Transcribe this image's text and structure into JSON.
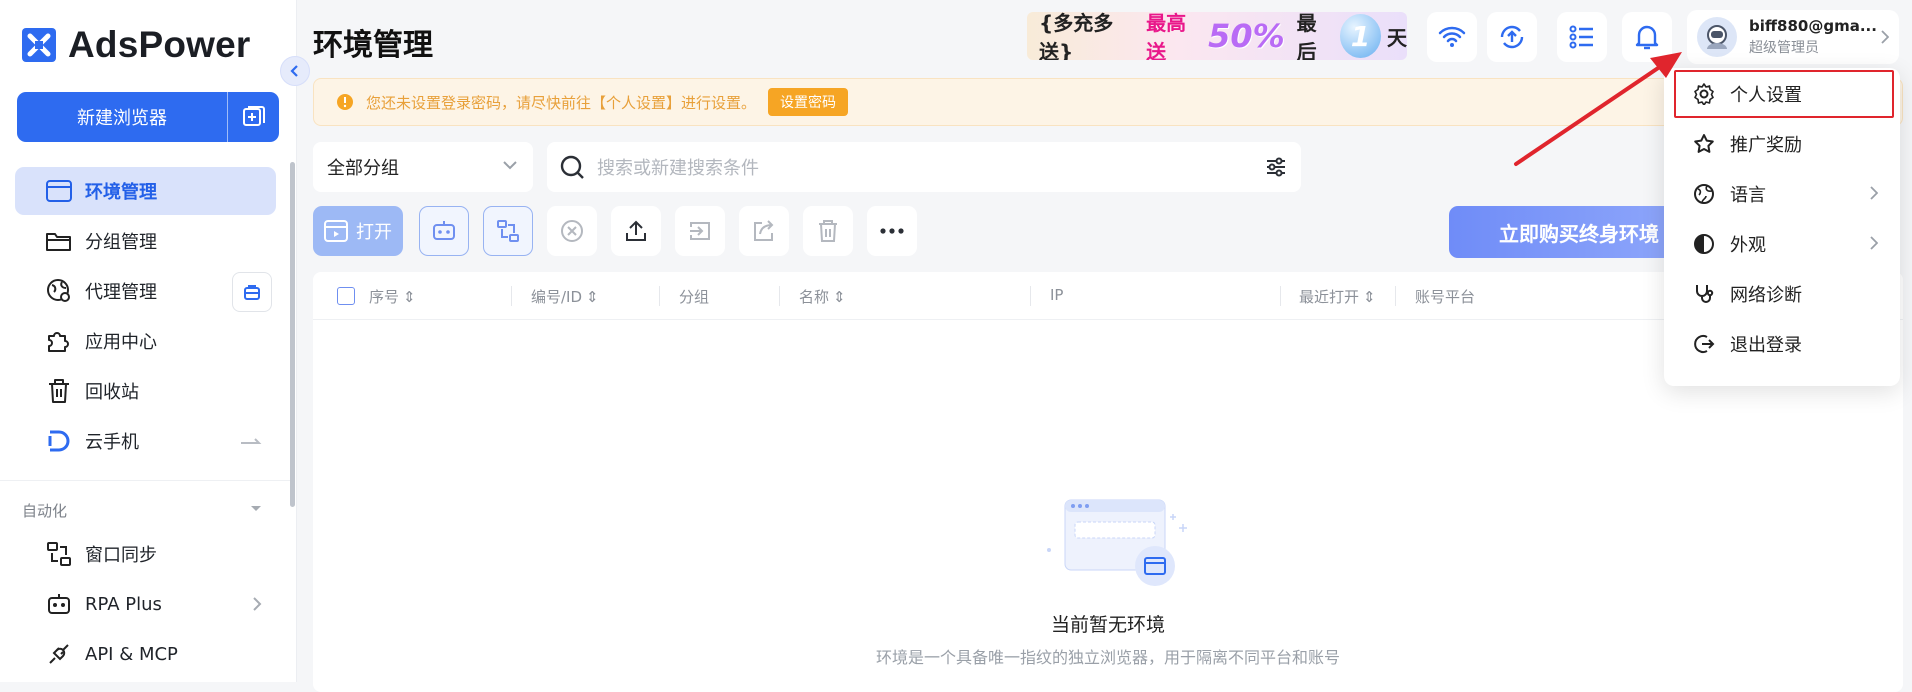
{
  "brand": {
    "name": "AdsPower"
  },
  "sidebar": {
    "new_browser": "新建浏览器",
    "nav": [
      {
        "label": "环境管理"
      },
      {
        "label": "分组管理"
      },
      {
        "label": "代理管理"
      },
      {
        "label": "应用中心"
      },
      {
        "label": "回收站"
      },
      {
        "label": "云手机"
      }
    ],
    "automation_label": "自动化",
    "automation": [
      {
        "label": "窗口同步"
      },
      {
        "label": "RPA Plus"
      },
      {
        "label": "API & MCP"
      }
    ]
  },
  "header": {
    "title": "环境管理",
    "promo": {
      "part1": "{多充多送}",
      "part2": "最高送",
      "percent": "50%",
      "part3": "最后",
      "days": "1",
      "part4": "天"
    },
    "user": {
      "name": "biff880@gma...",
      "role": "超级管理员"
    }
  },
  "warning": {
    "text": "您还未设置登录密码，请尽快前往【个人设置】进行设置。",
    "button": "设置密码"
  },
  "filters": {
    "group": "全部分组",
    "search_placeholder": "搜索或新建搜索条件"
  },
  "toolbar": {
    "open": "打开",
    "buy": "立即购买终身环境"
  },
  "table": {
    "headers": [
      "序号",
      "编号/ID",
      "分组",
      "名称",
      "IP",
      "最近打开",
      "账号平台"
    ],
    "empty_title": "当前暂无环境",
    "empty_desc": "环境是一个具备唯一指纹的独立浏览器，用于隔离不同平台和账号"
  },
  "dropdown": {
    "items": [
      {
        "label": "个人设置",
        "icon": "gear-icon"
      },
      {
        "label": "推广奖励",
        "icon": "star-icon"
      },
      {
        "label": "语言",
        "icon": "globe-icon"
      },
      {
        "label": "外观",
        "icon": "contrast-icon"
      },
      {
        "label": "网络诊断",
        "icon": "stethoscope-icon"
      },
      {
        "label": "退出登录",
        "icon": "logout-icon"
      }
    ]
  },
  "colors": {
    "accent": "#2e6bf0",
    "active_bg": "#d9e2fb",
    "warning": "#f6a524",
    "annotation": "#e0252d"
  }
}
